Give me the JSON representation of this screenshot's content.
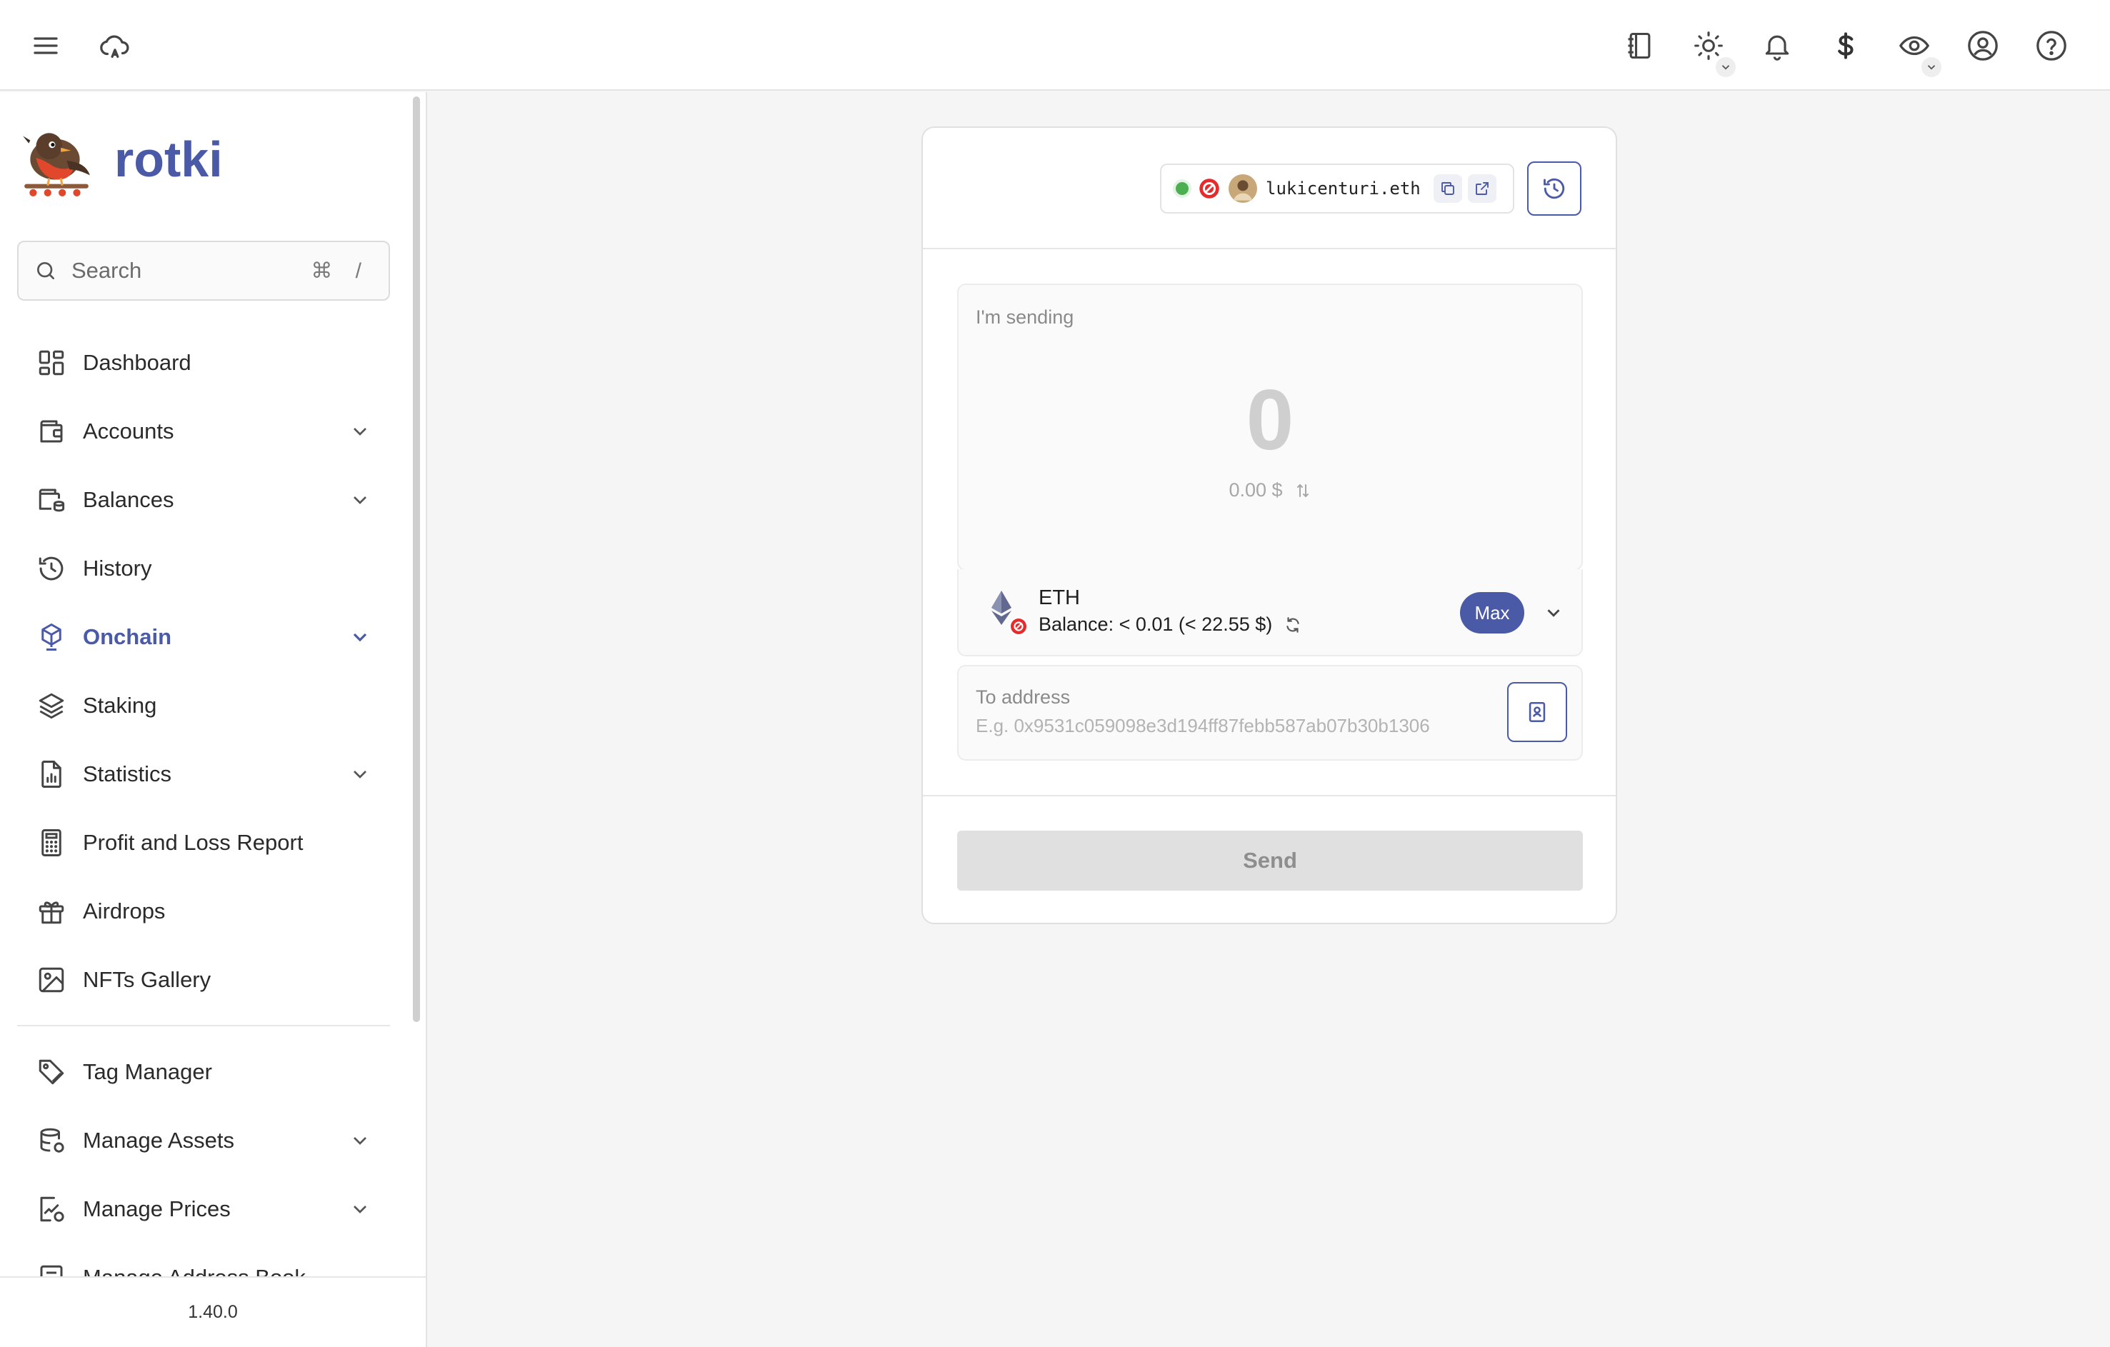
{
  "app": {
    "name": "rotki",
    "version": "1.40.0"
  },
  "search": {
    "placeholder": "Search",
    "shortcut": "⌘ /"
  },
  "topbar": {
    "icons": [
      "menu-icon",
      "cloud-sync-icon",
      "notes-icon",
      "theme-sun-icon",
      "bell-icon",
      "currency-dollar-icon",
      "privacy-eye-icon",
      "account-icon",
      "help-icon"
    ]
  },
  "sidebar": {
    "items": [
      {
        "label": "Dashboard",
        "icon": "dashboard-icon"
      },
      {
        "label": "Accounts",
        "icon": "wallet-icon"
      },
      {
        "label": "Balances",
        "icon": "balances-icon"
      },
      {
        "label": "History",
        "icon": "history-icon"
      },
      {
        "label": "Onchain",
        "icon": "onchain-cube-icon"
      },
      {
        "label": "Staking",
        "icon": "layers-icon"
      },
      {
        "label": "Statistics",
        "icon": "statistics-icon"
      },
      {
        "label": "Profit and Loss Report",
        "icon": "calculator-icon"
      },
      {
        "label": "Airdrops",
        "icon": "gift-icon"
      },
      {
        "label": "NFTs Gallery",
        "icon": "image-icon"
      },
      {
        "label": "Tag Manager",
        "icon": "tag-icon"
      },
      {
        "label": "Manage Assets",
        "icon": "database-icon"
      },
      {
        "label": "Manage Prices",
        "icon": "prices-icon"
      },
      {
        "label": "Manage Address Book",
        "icon": "address-book-icon"
      }
    ]
  },
  "account": {
    "name": "lukicenturi.eth",
    "status_color": "#4caf50"
  },
  "send": {
    "label": "I'm sending",
    "amount": "0",
    "fiat": "0.00 $",
    "asset": "ETH",
    "balance": "Balance: < 0.01 (< 22.55 $)",
    "max_label": "Max",
    "to_label": "To address",
    "to_placeholder": "E.g. 0x9531c059098e3d194ff87febb587ab07b30b1306",
    "send_label": "Send"
  },
  "colors": {
    "accent": "#4a5aa6",
    "robin_red": "#e0472b"
  }
}
